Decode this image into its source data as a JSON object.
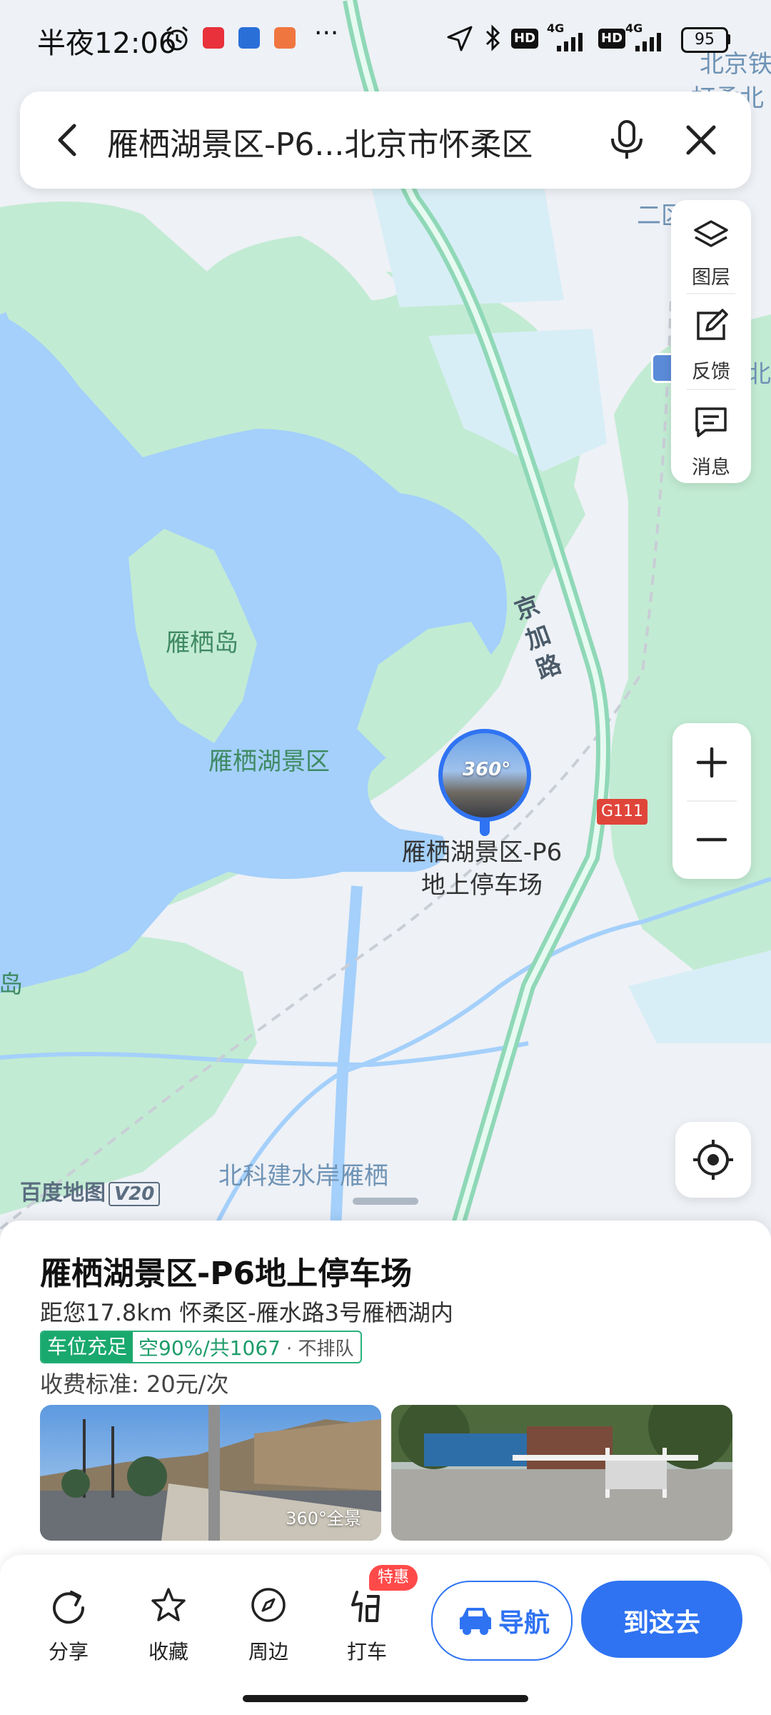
{
  "status_bar": {
    "time": "半夜12:06",
    "battery": "95",
    "network_1": "4G",
    "network_2": "4G",
    "hd_1": "HD",
    "hd_2": "HD",
    "more": "···"
  },
  "search": {
    "query": "雁栖湖景区-P6...北京市怀柔区"
  },
  "tools": [
    {
      "label": "图层",
      "icon": "layers-icon"
    },
    {
      "label": "反馈",
      "icon": "feedback-icon"
    },
    {
      "label": "消息",
      "icon": "message-icon"
    }
  ],
  "map": {
    "labels": {
      "island": "雁栖岛",
      "scenic": "雁栖湖景区",
      "road": "京加路",
      "community": "北科建水岸雁栖",
      "island_edge": "岛",
      "top_right_1": "北京铁",
      "top_right_2": "打柔北",
      "district_partial": "二区",
      "right_edge": "北京"
    },
    "highway_shield": "G111",
    "marker": {
      "pano_badge": "360°",
      "label_line1": "雁栖湖景区-P6",
      "label_line2": "地上停车场"
    },
    "brand": "百度地图",
    "brand_version": "V20",
    "colors": {
      "water": "#a4d0fb",
      "green": "#c2ebd3",
      "land": "#eef1f6",
      "road": "#b8edd6"
    }
  },
  "poi": {
    "title": "雁栖湖景区-P6地上停车场",
    "address": "距您17.8km  怀柔区-雁水路3号雁栖湖内",
    "tag_main": "车位充足",
    "tag_info": "空90%/共1067",
    "tag_note": "· 不排队",
    "fee": "收费标准: 20元/次",
    "photo_pano_tag": "360°全景"
  },
  "actions": {
    "share": "分享",
    "favorite": "收藏",
    "nearby": "周边",
    "taxi": "打车",
    "promo": "特惠",
    "navigate": "导航",
    "go_here": "到这去"
  },
  "accent": "#2f73f2"
}
